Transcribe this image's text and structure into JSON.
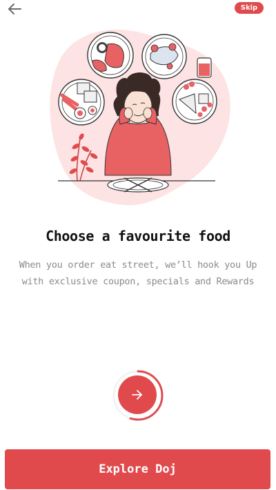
{
  "header": {
    "back_icon": "arrow-left-icon",
    "skip_label": "Skip"
  },
  "onboarding": {
    "title": "Choose a favourite food",
    "description": "When you order eat street, we’ll hook you Up with exclusive coupon, specials and Rewards",
    "step_progress": 0.55,
    "next_icon": "arrow-right-icon",
    "cta_label": "Explore Doj"
  },
  "colors": {
    "accent": "#e04a4d",
    "title": "#111111",
    "body_text": "#8a8a8a",
    "illustration_bg": "#fde3e3"
  }
}
